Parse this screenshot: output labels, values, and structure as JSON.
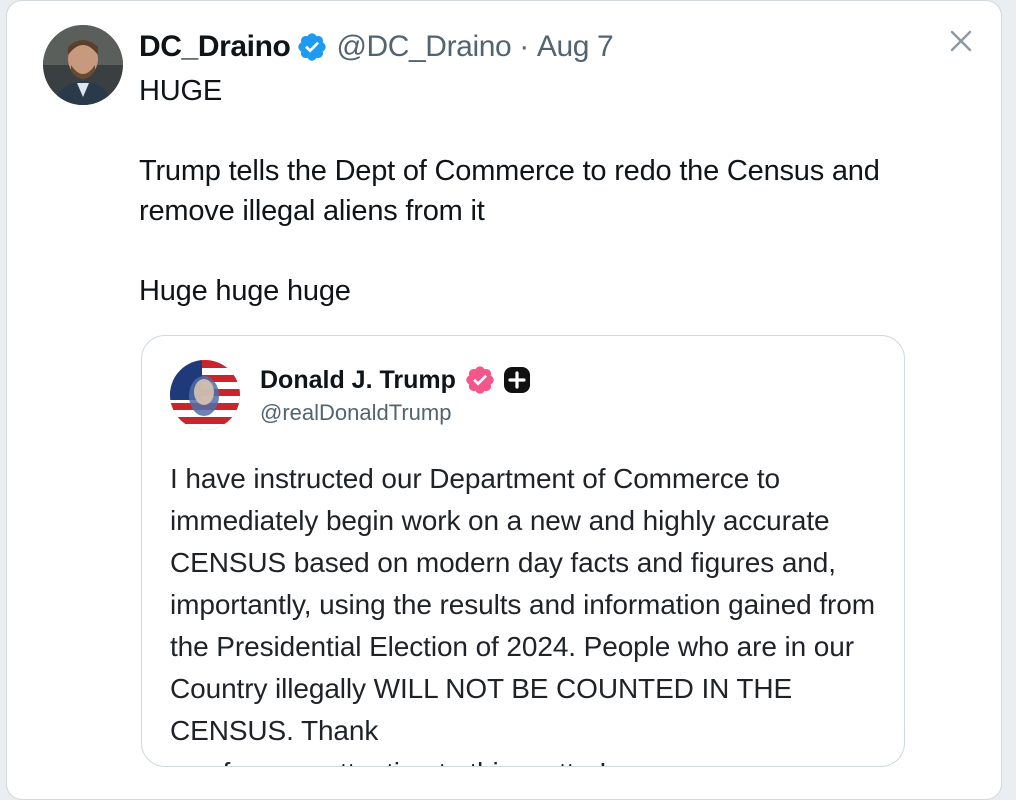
{
  "tweet": {
    "display_name": "DC_Draino",
    "handle": "@DC_Draino",
    "separator": "·",
    "date": "Aug 7",
    "text": "HUGE\n\nTrump tells the Dept of Commerce to redo the Census and remove illegal aliens from it\n\nHuge huge huge",
    "verified_color": "#1d9bf0",
    "avatar_icon": "profile-photo"
  },
  "quote": {
    "display_name": "Donald J. Trump",
    "handle": "@realDonaldTrump",
    "verified_color": "#f4568b",
    "text": "I have instructed our Department of Commerce to immediately begin work on a new and highly accurate CENSUS based on modern day facts and figures and, importantly, using the results and information gained from the Presidential Election of 2024. People who are in our Country illegally WILL NOT BE COUNTED IN THE CENSUS. Thank",
    "text_cutoff": "you for your attention to this matter!"
  },
  "controls": {
    "close_icon": "close-icon"
  }
}
